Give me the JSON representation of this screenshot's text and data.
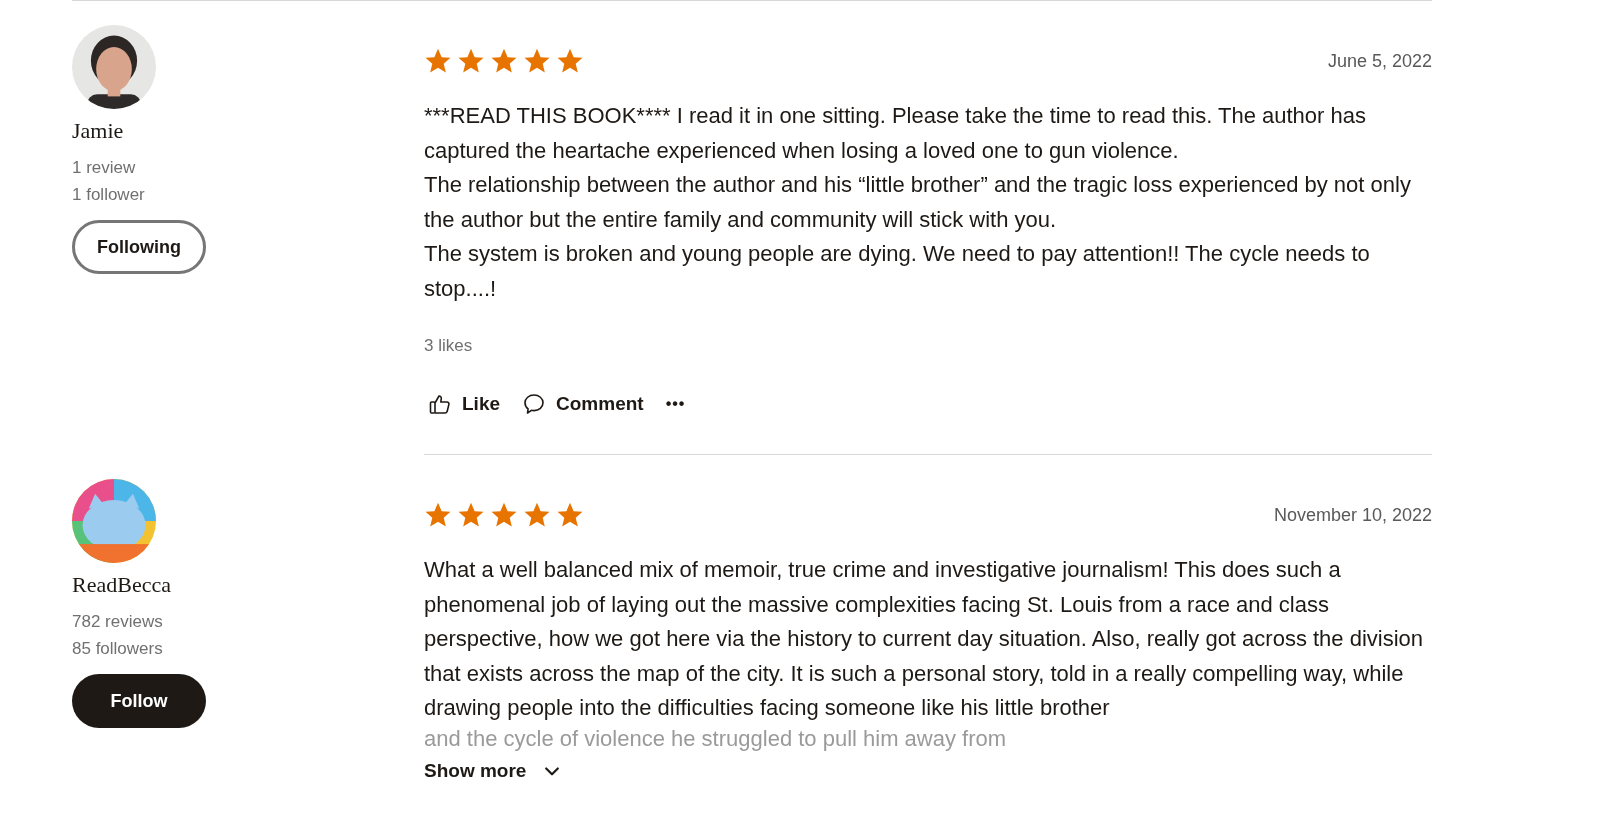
{
  "reviews": [
    {
      "reviewer": {
        "name": "Jamie",
        "stats": [
          "1 review",
          "1 follower"
        ],
        "follow_button": {
          "label": "Following",
          "following": true
        }
      },
      "stars": 5,
      "date": "June 5, 2022",
      "paragraphs": [
        "***READ THIS BOOK**** I read it in one sitting. Please take the time to read this. The author has captured the heartache experienced when losing a loved one to gun violence.",
        "The relationship between the author and his “little brother” and the tragic loss experienced by not only the author but the entire family and community will stick with you.",
        "The system is broken and young people are dying. We need to pay attention!! The cycle needs to stop....!"
      ],
      "likes": "3 likes",
      "actions": [
        {
          "kind": "like",
          "label": "Like"
        },
        {
          "kind": "comment",
          "label": "Comment"
        },
        {
          "kind": "more",
          "label": "•••"
        }
      ]
    },
    {
      "reviewer": {
        "name": "ReadBecca",
        "stats": [
          "782 reviews",
          "85 followers"
        ],
        "follow_button": {
          "label": "Follow",
          "following": false
        }
      },
      "stars": 5,
      "date": "November 10, 2022",
      "paragraphs": [
        "What a well balanced mix of memoir, true crime and investigative journalism! This does such a phenomenal job of laying out the massive complexities facing St. Louis from a race and class perspective, how we got here via the history to current day situation. Also, really got across the division that exists across the map of the city. It is such a personal story, told in a really compelling way, while drawing people into the difficulties facing someone like his little brother"
      ],
      "faded_text": "and the cycle of violence he struggled to pull him away from",
      "show_more": "Show more"
    }
  ]
}
